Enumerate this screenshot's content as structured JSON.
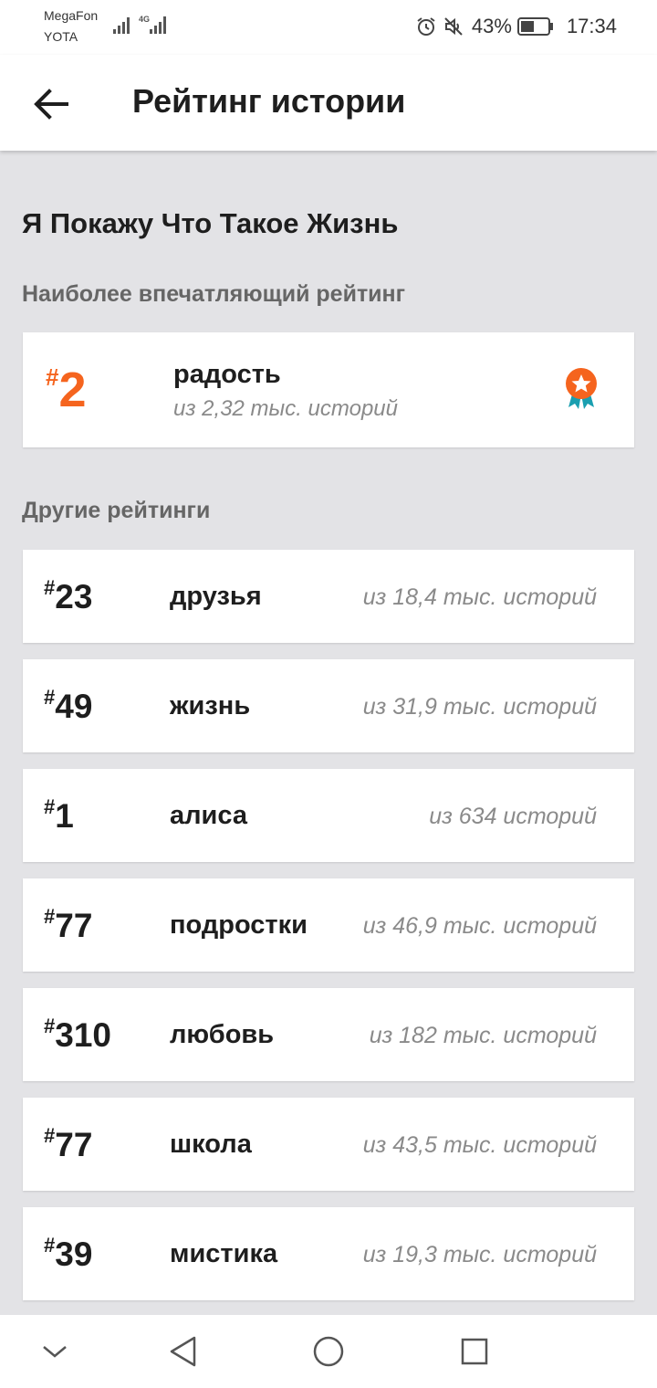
{
  "status_bar": {
    "carrier_1": "MegaFon",
    "carrier_2": "YOTA",
    "network": "4G",
    "battery": "43%",
    "time": "17:34"
  },
  "app_bar": {
    "title": "Рейтинг истории",
    "back_icon": "arrow-left-icon"
  },
  "story": {
    "title": "Я Покажу Что Такое Жизнь"
  },
  "top_section": {
    "label": "Наиболее впечатляющий рейтинг",
    "item": {
      "hash": "#",
      "rank": "2",
      "tag": "радость",
      "count": "из 2,32 тыс. историй",
      "badge_icon": "award-ribbon-icon"
    }
  },
  "other_section": {
    "label": "Другие рейтинги",
    "items": [
      {
        "hash": "#",
        "rank": "23",
        "tag": "друзья",
        "count": "из 18,4 тыс. историй"
      },
      {
        "hash": "#",
        "rank": "49",
        "tag": "жизнь",
        "count": "из 31,9 тыс. историй"
      },
      {
        "hash": "#",
        "rank": "1",
        "tag": "алиса",
        "count": "из 634 историй"
      },
      {
        "hash": "#",
        "rank": "77",
        "tag": "подростки",
        "count": "из 46,9 тыс. историй"
      },
      {
        "hash": "#",
        "rank": "310",
        "tag": "любовь",
        "count": "из 182 тыс. историй"
      },
      {
        "hash": "#",
        "rank": "77",
        "tag": "школа",
        "count": "из 43,5 тыс. историй"
      },
      {
        "hash": "#",
        "rank": "39",
        "tag": "мистика",
        "count": "из 19,3 тыс. историй"
      }
    ]
  },
  "colors": {
    "accent": "#f5641e",
    "badge_ribbon": "#1a9fb0",
    "background": "#e3e3e6"
  }
}
